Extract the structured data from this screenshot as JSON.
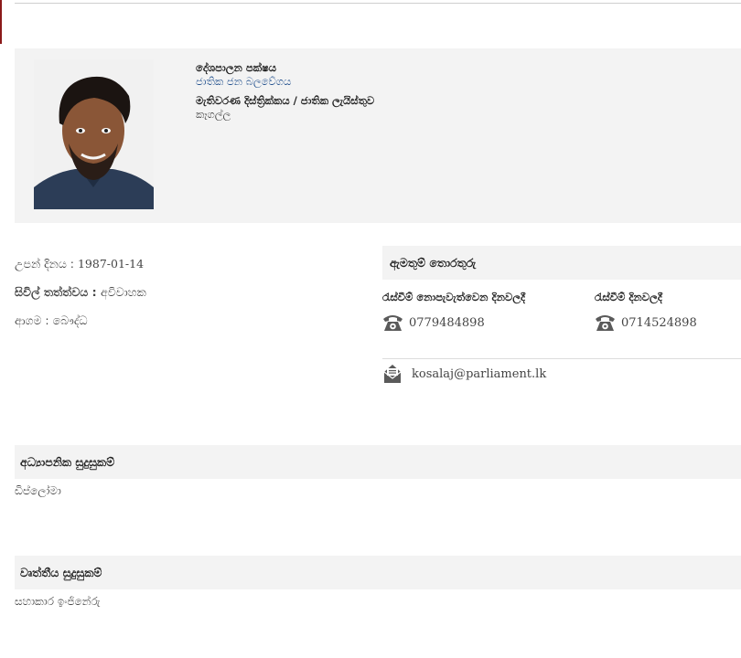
{
  "profile": {
    "party_label": "දේශපාලන පක්ෂය",
    "party_value": "ජාතික ජන බලවේගය",
    "district_label": "මැතිවරණ දිස්ත්‍රික්කය / ජාතික ලැයිස්තුව",
    "district_value": "කෑගල්ල"
  },
  "details": [
    {
      "label": "උපන් දිනය : ",
      "value": "1987-01-14"
    },
    {
      "label": "සිවිල් තත්ත්වය : ",
      "value": "අවිවාහක"
    },
    {
      "label": "ආගම : ",
      "value": "බෞද්ධ"
    }
  ],
  "contact": {
    "title": "ඇමතුම් තොරතුරු",
    "non_sitting_label": "රැස්වීම් නොපැවැත්වෙන දිනවලදී",
    "non_sitting_phone": "0779484898",
    "sitting_label": "රැස්වීම් දිනවලදී",
    "sitting_phone": "0714524898",
    "email": "kosalaj@parliament.lk"
  },
  "education": {
    "title": "අධ්‍යාපනික සුදුසුකම්",
    "value": "ඩිප්ලෝමා"
  },
  "profession": {
    "title": "වෘත්තීය සුදුසුකම්",
    "value": "සහාකාර ඉංජිනේරු"
  },
  "icons": {
    "phone": "telephone-icon",
    "email": "envelope-icon"
  },
  "colors": {
    "accent": "#8b1a1a",
    "link": "#1f4e8c",
    "panel": "#f3f3f3",
    "icon": "#5a5a5a"
  }
}
